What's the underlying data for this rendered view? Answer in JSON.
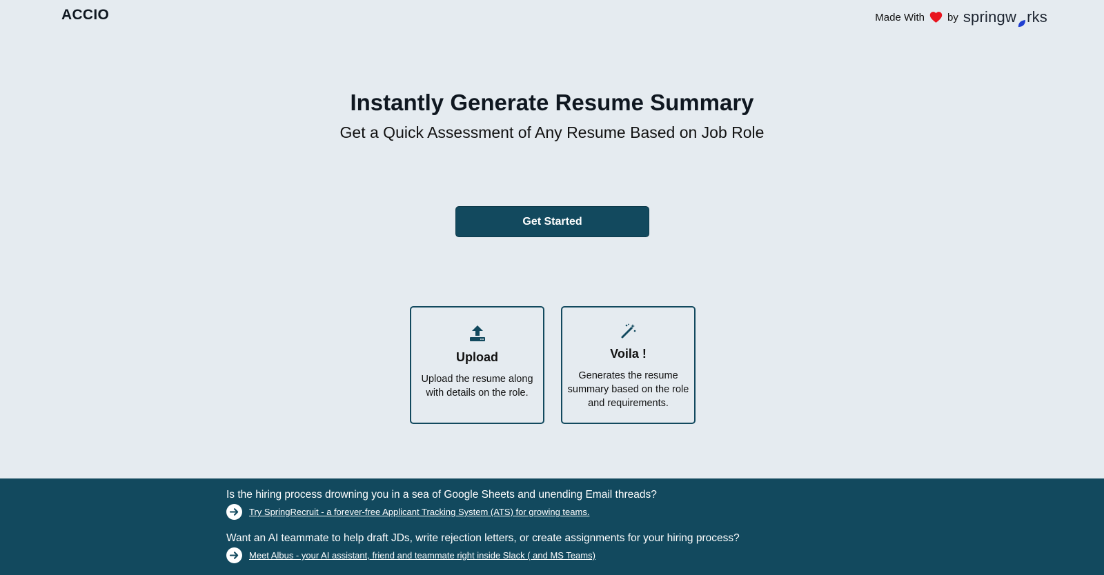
{
  "header": {
    "logo": "ACCIO",
    "made_with_label": "Made With",
    "by_label": "by",
    "brand_prefix": "springw",
    "brand_suffix": "rks"
  },
  "hero": {
    "title": "Instantly Generate Resume Summary",
    "subtitle": "Get a Quick Assessment of Any Resume Based on Job Role",
    "cta_label": "Get Started"
  },
  "cards": [
    {
      "icon": "upload-icon",
      "title": "Upload",
      "description": "Upload the resume along with details on the role."
    },
    {
      "icon": "magic-wand-icon",
      "title": "Voila !",
      "description": "Generates the resume summary based on the role and requirements."
    }
  ],
  "footer": {
    "question_1": "Is the hiring process drowning you in a sea of Google Sheets and unending Email threads?",
    "link_1": "Try SpringRecruit - a forever-free Applicant Tracking System (ATS) for growing teams.",
    "question_2": "Want an AI teammate to help draft JDs, write rejection letters, or create assignments for your hiring process?",
    "link_2": "Meet Albus - your AI assistant, friend and teammate right inside Slack ( and MS Teams)"
  },
  "colors": {
    "background": "#e5ebf0",
    "primary": "#12495e",
    "heart": "#e8141e",
    "leaf": "#1f3fd1"
  }
}
